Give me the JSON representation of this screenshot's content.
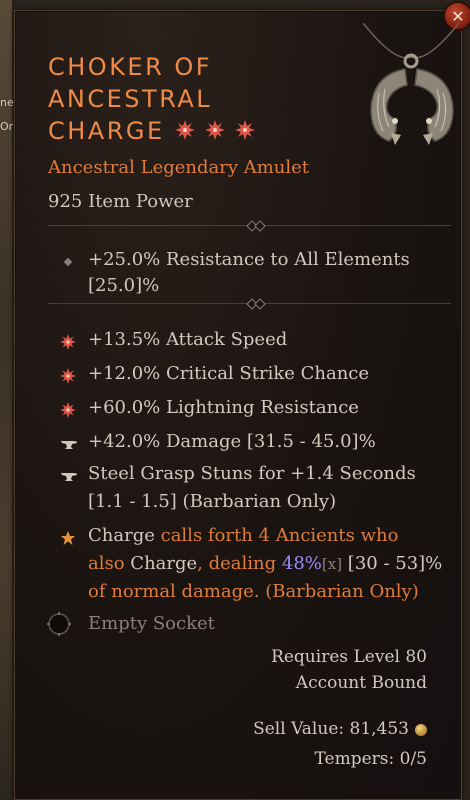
{
  "background": {
    "fragments": [
      "ne",
      "Or"
    ]
  },
  "tooltip": {
    "close_symbol": "✕",
    "title_lines": [
      "Choker of",
      "Ancestral",
      "Charge"
    ],
    "greater_affix_count": 3,
    "item_type": "Ancestral Legendary Amulet",
    "item_power": "925 Item Power",
    "implicit": {
      "icon": "diamond-bullet-icon",
      "line1": "+25.0% Resistance to All Elements",
      "line2": "[25.0]%"
    },
    "affixes": [
      {
        "icon": "greater-affix-icon",
        "text": "+13.5% Attack Speed"
      },
      {
        "icon": "greater-affix-icon",
        "text": "+12.0% Critical Strike Chance"
      },
      {
        "icon": "greater-affix-icon",
        "text": "+60.0% Lightning Resistance"
      },
      {
        "icon": "anvil-icon",
        "text": "+42.0% Damage [31.5 - 45.0]%"
      }
    ],
    "tempered": {
      "icon": "anvil-icon",
      "name": "Steel Grasp",
      "rest": " Stuns for +1.4 Seconds",
      "line2": "[1.1 - 1.5] (Barbarian Only)"
    },
    "legendary_aspect": {
      "icon": "legendary-star-icon",
      "l1_a": "Charge",
      "l1_b": " calls forth 4 Ancients who",
      "l2_a": "also ",
      "l2_b": "Charge",
      "l2_c": ", dealing ",
      "l2_d": "48%",
      "l2_e": "[x]",
      "l2_f": " [30 - 53]%",
      "l3": "of normal damage. (Barbarian Only)"
    },
    "socket": {
      "icon": "empty-socket-icon",
      "text": "Empty Socket"
    },
    "requirements": {
      "level": "Requires Level 80",
      "binding": "Account Bound"
    },
    "sell_value": {
      "label": "Sell Value: 81,453",
      "icon": "gold-coin-icon"
    },
    "tempers": "Tempers: 0/5",
    "colors": {
      "title": "#ef8a47",
      "legendary": "#e07c3c",
      "affix_text": "#d2c9bf",
      "percent_highlight": "#9a8cf5",
      "greater_affix_icon": "#e0584a"
    }
  }
}
